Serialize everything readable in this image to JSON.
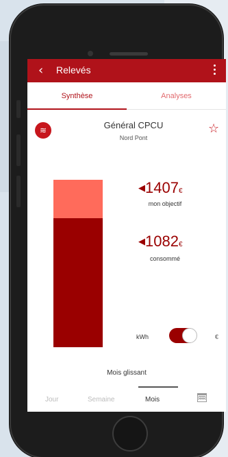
{
  "appbar": {
    "back_label": "Relevés",
    "back_icon": "chevron-left-icon",
    "menu_icon": "more-vertical-icon"
  },
  "tabs": [
    {
      "label": "Synthèse",
      "active": true
    },
    {
      "label": "Analyses",
      "active": false
    }
  ],
  "site": {
    "name": "Général CPCU",
    "subtitle": "Nord Pont",
    "icon": "heating-icon",
    "favorite_icon": "star-outline-icon"
  },
  "gauge": {
    "objective_fraction": 1.0,
    "consumed_fraction": 0.769
  },
  "values": {
    "objective": {
      "amount": "1407",
      "currency": "€",
      "label": "mon objectif"
    },
    "consumed": {
      "amount": "1082",
      "currency": "€",
      "label": "consommé"
    }
  },
  "unit_toggle": {
    "left_label": "kWh",
    "right_label": "€",
    "selected": "€"
  },
  "period_label": "Mois glissant",
  "bottom_nav": {
    "items": [
      {
        "label": "Jour",
        "active": false
      },
      {
        "label": "Semaine",
        "active": false
      },
      {
        "label": "Mois",
        "active": true
      }
    ],
    "calendar_icon": "calendar-icon"
  },
  "colors": {
    "brand": "#b0121a",
    "gauge_dark": "#9a0000",
    "gauge_light": "#ff6b5b"
  }
}
